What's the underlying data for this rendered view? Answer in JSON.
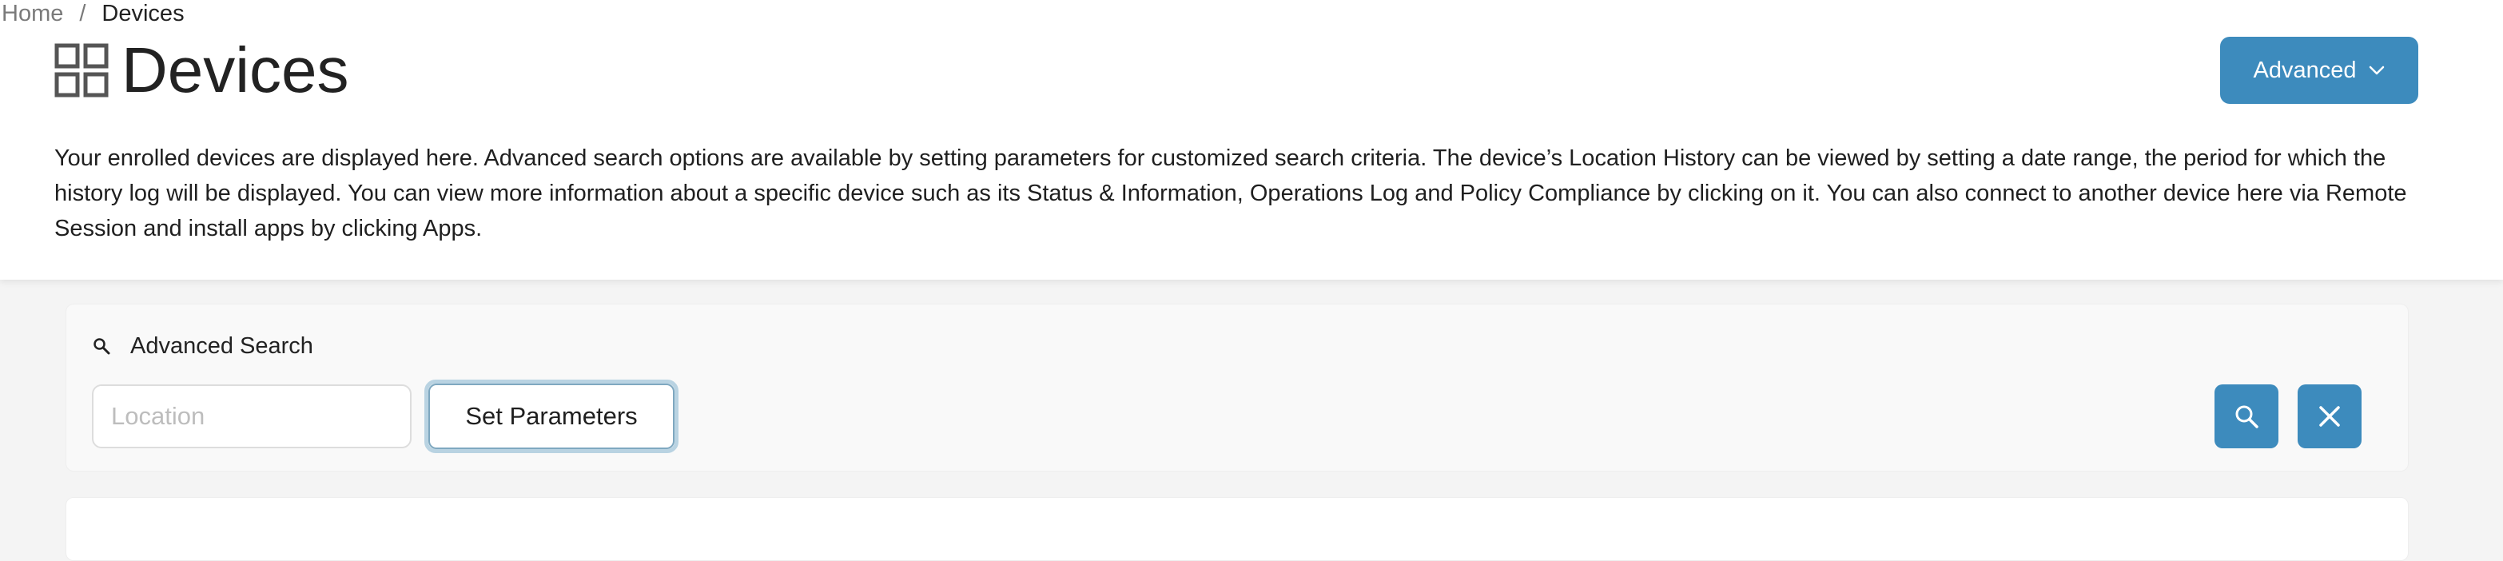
{
  "breadcrumb": {
    "home": "Home",
    "separator": "/",
    "current": "Devices"
  },
  "page": {
    "title": "Devices",
    "title_icon": "grid-icon",
    "description": "Your enrolled devices are displayed here. Advanced search options are available by setting parameters for customized search criteria. The device’s Location History can be viewed by setting a date range, the period for which the history log will be displayed. You can view more information about a specific device such as its Status & Information, Operations Log and Policy Compliance by clicking on it. You can also connect to another device here via Remote Session and install apps by clicking Apps."
  },
  "advanced_menu": {
    "label": "Advanced",
    "icon": "chevron-down-icon"
  },
  "search": {
    "heading": "Advanced Search",
    "heading_icon": "search-icon",
    "location_placeholder": "Location",
    "location_value": "",
    "set_parameters_label": "Set Parameters",
    "search_button_icon": "search-icon",
    "clear_button_icon": "close-icon"
  },
  "colors": {
    "accent": "#3d8bbd",
    "focus_ring": "#b9d3e2",
    "page_background": "#f4f4f4",
    "panel_background": "#f9f9f9"
  }
}
